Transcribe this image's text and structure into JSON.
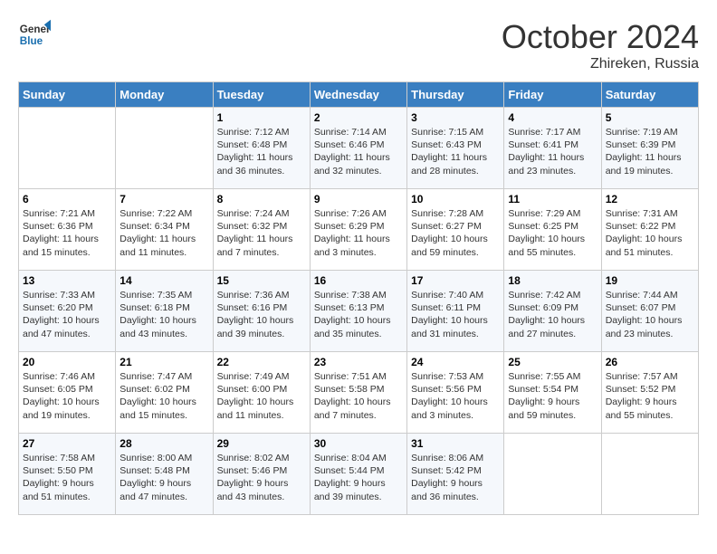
{
  "logo": {
    "line1": "General",
    "line2": "Blue"
  },
  "title": "October 2024",
  "location": "Zhireken, Russia",
  "days_of_week": [
    "Sunday",
    "Monday",
    "Tuesday",
    "Wednesday",
    "Thursday",
    "Friday",
    "Saturday"
  ],
  "weeks": [
    [
      {
        "day": "",
        "info": ""
      },
      {
        "day": "",
        "info": ""
      },
      {
        "day": "1",
        "info": "Sunrise: 7:12 AM\nSunset: 6:48 PM\nDaylight: 11 hours and 36 minutes."
      },
      {
        "day": "2",
        "info": "Sunrise: 7:14 AM\nSunset: 6:46 PM\nDaylight: 11 hours and 32 minutes."
      },
      {
        "day": "3",
        "info": "Sunrise: 7:15 AM\nSunset: 6:43 PM\nDaylight: 11 hours and 28 minutes."
      },
      {
        "day": "4",
        "info": "Sunrise: 7:17 AM\nSunset: 6:41 PM\nDaylight: 11 hours and 23 minutes."
      },
      {
        "day": "5",
        "info": "Sunrise: 7:19 AM\nSunset: 6:39 PM\nDaylight: 11 hours and 19 minutes."
      }
    ],
    [
      {
        "day": "6",
        "info": "Sunrise: 7:21 AM\nSunset: 6:36 PM\nDaylight: 11 hours and 15 minutes."
      },
      {
        "day": "7",
        "info": "Sunrise: 7:22 AM\nSunset: 6:34 PM\nDaylight: 11 hours and 11 minutes."
      },
      {
        "day": "8",
        "info": "Sunrise: 7:24 AM\nSunset: 6:32 PM\nDaylight: 11 hours and 7 minutes."
      },
      {
        "day": "9",
        "info": "Sunrise: 7:26 AM\nSunset: 6:29 PM\nDaylight: 11 hours and 3 minutes."
      },
      {
        "day": "10",
        "info": "Sunrise: 7:28 AM\nSunset: 6:27 PM\nDaylight: 10 hours and 59 minutes."
      },
      {
        "day": "11",
        "info": "Sunrise: 7:29 AM\nSunset: 6:25 PM\nDaylight: 10 hours and 55 minutes."
      },
      {
        "day": "12",
        "info": "Sunrise: 7:31 AM\nSunset: 6:22 PM\nDaylight: 10 hours and 51 minutes."
      }
    ],
    [
      {
        "day": "13",
        "info": "Sunrise: 7:33 AM\nSunset: 6:20 PM\nDaylight: 10 hours and 47 minutes."
      },
      {
        "day": "14",
        "info": "Sunrise: 7:35 AM\nSunset: 6:18 PM\nDaylight: 10 hours and 43 minutes."
      },
      {
        "day": "15",
        "info": "Sunrise: 7:36 AM\nSunset: 6:16 PM\nDaylight: 10 hours and 39 minutes."
      },
      {
        "day": "16",
        "info": "Sunrise: 7:38 AM\nSunset: 6:13 PM\nDaylight: 10 hours and 35 minutes."
      },
      {
        "day": "17",
        "info": "Sunrise: 7:40 AM\nSunset: 6:11 PM\nDaylight: 10 hours and 31 minutes."
      },
      {
        "day": "18",
        "info": "Sunrise: 7:42 AM\nSunset: 6:09 PM\nDaylight: 10 hours and 27 minutes."
      },
      {
        "day": "19",
        "info": "Sunrise: 7:44 AM\nSunset: 6:07 PM\nDaylight: 10 hours and 23 minutes."
      }
    ],
    [
      {
        "day": "20",
        "info": "Sunrise: 7:46 AM\nSunset: 6:05 PM\nDaylight: 10 hours and 19 minutes."
      },
      {
        "day": "21",
        "info": "Sunrise: 7:47 AM\nSunset: 6:02 PM\nDaylight: 10 hours and 15 minutes."
      },
      {
        "day": "22",
        "info": "Sunrise: 7:49 AM\nSunset: 6:00 PM\nDaylight: 10 hours and 11 minutes."
      },
      {
        "day": "23",
        "info": "Sunrise: 7:51 AM\nSunset: 5:58 PM\nDaylight: 10 hours and 7 minutes."
      },
      {
        "day": "24",
        "info": "Sunrise: 7:53 AM\nSunset: 5:56 PM\nDaylight: 10 hours and 3 minutes."
      },
      {
        "day": "25",
        "info": "Sunrise: 7:55 AM\nSunset: 5:54 PM\nDaylight: 9 hours and 59 minutes."
      },
      {
        "day": "26",
        "info": "Sunrise: 7:57 AM\nSunset: 5:52 PM\nDaylight: 9 hours and 55 minutes."
      }
    ],
    [
      {
        "day": "27",
        "info": "Sunrise: 7:58 AM\nSunset: 5:50 PM\nDaylight: 9 hours and 51 minutes."
      },
      {
        "day": "28",
        "info": "Sunrise: 8:00 AM\nSunset: 5:48 PM\nDaylight: 9 hours and 47 minutes."
      },
      {
        "day": "29",
        "info": "Sunrise: 8:02 AM\nSunset: 5:46 PM\nDaylight: 9 hours and 43 minutes."
      },
      {
        "day": "30",
        "info": "Sunrise: 8:04 AM\nSunset: 5:44 PM\nDaylight: 9 hours and 39 minutes."
      },
      {
        "day": "31",
        "info": "Sunrise: 8:06 AM\nSunset: 5:42 PM\nDaylight: 9 hours and 36 minutes."
      },
      {
        "day": "",
        "info": ""
      },
      {
        "day": "",
        "info": ""
      }
    ]
  ]
}
